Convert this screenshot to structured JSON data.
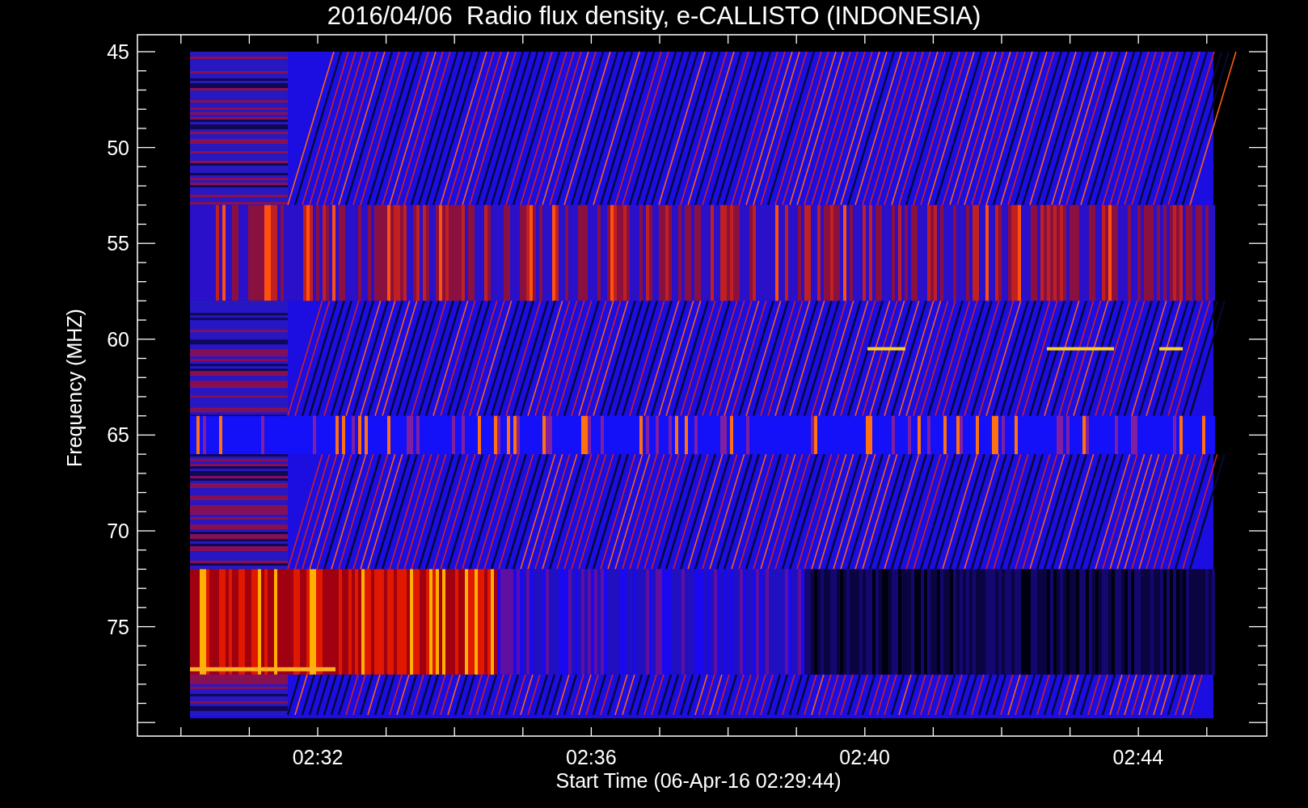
{
  "title": "2016/04/06  Radio flux density, e-CALLISTO (INDONESIA)",
  "y_axis": {
    "label": "Frequency (MHZ)",
    "ticks": [
      "45",
      "50",
      "55",
      "60",
      "65",
      "70",
      "75"
    ]
  },
  "x_axis": {
    "label": "Start Time (06-Apr-16 02:29:44)",
    "ticks": [
      "02:32",
      "02:36",
      "02:40",
      "02:44"
    ]
  }
}
